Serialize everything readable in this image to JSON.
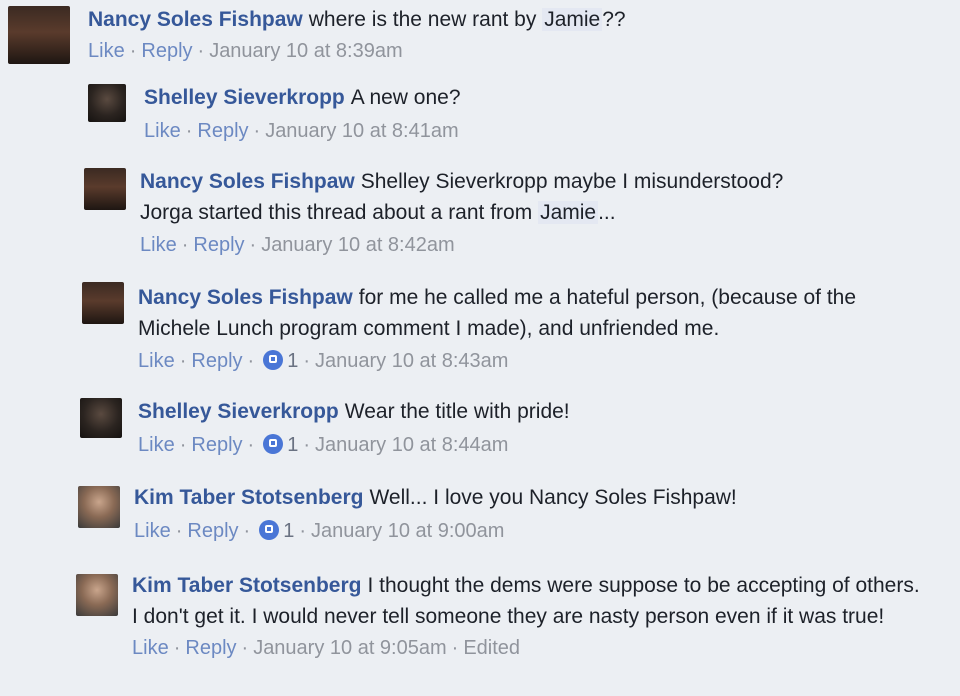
{
  "comments": [
    {
      "author": "Nancy Soles Fishpaw",
      "text_before": "where is the new rant by",
      "mention": "Jamie",
      "text_after": "??",
      "actions": {
        "like": "Like",
        "reply": "Reply",
        "time": "January 10 at 8:39am"
      }
    },
    {
      "author": "Shelley Sieverkropp",
      "text": "A new one?",
      "actions": {
        "like": "Like",
        "reply": "Reply",
        "time": "January 10 at 8:41am"
      }
    },
    {
      "author": "Nancy Soles Fishpaw",
      "text_line1": "Shelley Sieverkropp maybe I misunderstood?",
      "text_line2_before": "Jorga started this thread about a rant from",
      "mention": "Jamie",
      "text_after": "...",
      "actions": {
        "like": "Like",
        "reply": "Reply",
        "time": "January 10 at 8:42am"
      }
    },
    {
      "author": "Nancy Soles Fishpaw",
      "text": "for me he called me a hateful person, (because of the Michele Lunch program comment I made), and unfriended me.",
      "actions": {
        "like": "Like",
        "reply": "Reply",
        "like_count": "1",
        "time": "January 10 at 8:43am"
      }
    },
    {
      "author": "Shelley Sieverkropp",
      "text": "Wear the title with pride!",
      "actions": {
        "like": "Like",
        "reply": "Reply",
        "like_count": "1",
        "time": "January 10 at 8:44am"
      }
    },
    {
      "author": "Kim Taber Stotsenberg",
      "text": "Well... I love you Nancy Soles Fishpaw!",
      "actions": {
        "like": "Like",
        "reply": "Reply",
        "like_count": "1",
        "time": "January 10 at 9:00am"
      }
    },
    {
      "author": "Kim Taber Stotsenberg",
      "text": "I thought the dems were suppose to be accepting of others. I don't get it. I would never tell someone they are nasty person even if it was true!",
      "actions": {
        "like": "Like",
        "reply": "Reply",
        "time": "January 10 at 9:05am",
        "edited": "Edited"
      }
    }
  ],
  "colors": {
    "author": "#365899",
    "link": "#4267b2",
    "meta": "#90949c",
    "like_badge": "#4a76d6"
  }
}
